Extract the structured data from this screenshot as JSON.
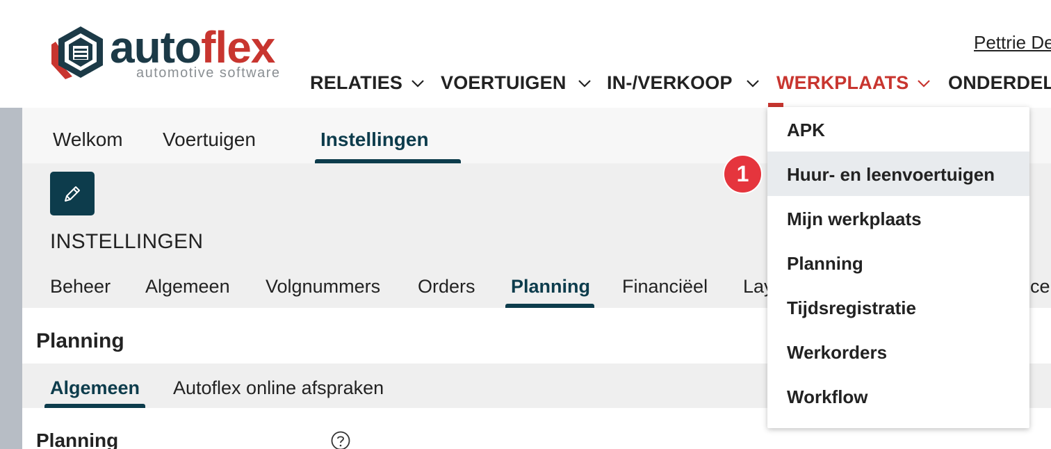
{
  "header": {
    "logo": {
      "word_part1": "auto",
      "word_part2": "flex",
      "tagline": "automotive software"
    },
    "user_name": "Pettrie De",
    "nav": [
      {
        "label": "RELATIES"
      },
      {
        "label": "VOERTUIGEN"
      },
      {
        "label": "IN-/VERKOOP"
      },
      {
        "label": "WERKPLAATS",
        "active": true
      },
      {
        "label": "ONDERDEL"
      }
    ]
  },
  "top_tabs": [
    {
      "label": "Welkom"
    },
    {
      "label": "Voertuigen"
    },
    {
      "label": "Instellingen",
      "active": true
    }
  ],
  "settings": {
    "title": "INSTELLINGEN",
    "tabs": [
      {
        "label": "Beheer"
      },
      {
        "label": "Algemeen"
      },
      {
        "label": "Volgnummers"
      },
      {
        "label": "Orders"
      },
      {
        "label": "Planning",
        "active": true
      },
      {
        "label": "Financiëel"
      },
      {
        "label": "Lay"
      },
      {
        "label": "ce"
      }
    ]
  },
  "section": {
    "title": "Planning",
    "subtabs": [
      {
        "label": "Algemeen",
        "active": true
      },
      {
        "label": "Autoflex online afspraken"
      }
    ],
    "field_label": "Planning"
  },
  "dropdown": {
    "items": [
      {
        "label": "APK"
      },
      {
        "label": "Huur- en leenvoertuigen",
        "hovered": true
      },
      {
        "label": "Mijn werkplaats"
      },
      {
        "label": "Planning"
      },
      {
        "label": "Tijdsregistratie"
      },
      {
        "label": "Werkorders"
      },
      {
        "label": "Workflow"
      }
    ]
  },
  "step_badge": "1",
  "colors": {
    "brand_dark": "#0d3c4c",
    "brand_red": "#c8352f",
    "badge_red": "#e5353d"
  }
}
